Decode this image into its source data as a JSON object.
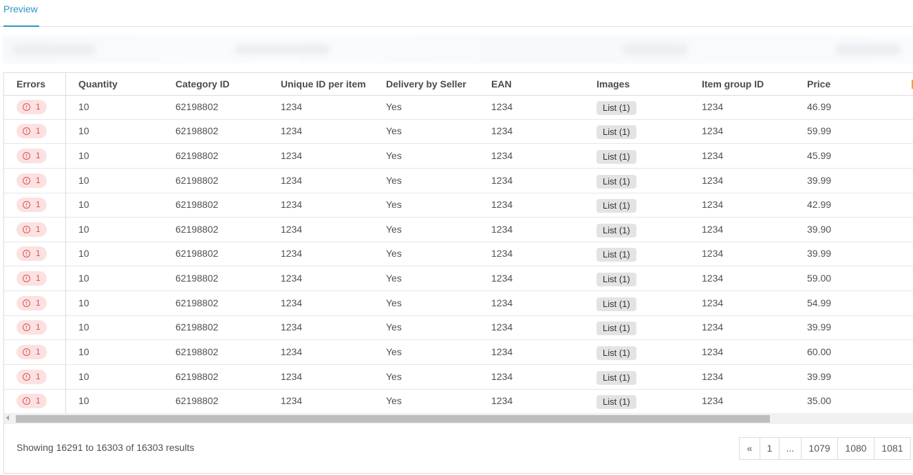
{
  "tabs": [
    {
      "label": "Preview"
    }
  ],
  "table": {
    "headers": [
      "Errors",
      "Quantity",
      "Category ID",
      "Unique ID per item",
      "Delivery by Seller",
      "EAN",
      "Images",
      "Item group ID",
      "Price"
    ],
    "rows": [
      {
        "errors": "1",
        "quantity": "10",
        "category_id": "62198802",
        "unique_id": "1234",
        "delivery": "Yes",
        "ean": "1234",
        "images": "List (1)",
        "item_group_id": "1234",
        "price": "46.99"
      },
      {
        "errors": "1",
        "quantity": "10",
        "category_id": "62198802",
        "unique_id": "1234",
        "delivery": "Yes",
        "ean": "1234",
        "images": "List (1)",
        "item_group_id": "1234",
        "price": "59.99"
      },
      {
        "errors": "1",
        "quantity": "10",
        "category_id": "62198802",
        "unique_id": "1234",
        "delivery": "Yes",
        "ean": "1234",
        "images": "List (1)",
        "item_group_id": "1234",
        "price": "45.99"
      },
      {
        "errors": "1",
        "quantity": "10",
        "category_id": "62198802",
        "unique_id": "1234",
        "delivery": "Yes",
        "ean": "1234",
        "images": "List (1)",
        "item_group_id": "1234",
        "price": "39.99"
      },
      {
        "errors": "1",
        "quantity": "10",
        "category_id": "62198802",
        "unique_id": "1234",
        "delivery": "Yes",
        "ean": "1234",
        "images": "List (1)",
        "item_group_id": "1234",
        "price": "42.99"
      },
      {
        "errors": "1",
        "quantity": "10",
        "category_id": "62198802",
        "unique_id": "1234",
        "delivery": "Yes",
        "ean": "1234",
        "images": "List (1)",
        "item_group_id": "1234",
        "price": "39.90"
      },
      {
        "errors": "1",
        "quantity": "10",
        "category_id": "62198802",
        "unique_id": "1234",
        "delivery": "Yes",
        "ean": "1234",
        "images": "List (1)",
        "item_group_id": "1234",
        "price": "39.99"
      },
      {
        "errors": "1",
        "quantity": "10",
        "category_id": "62198802",
        "unique_id": "1234",
        "delivery": "Yes",
        "ean": "1234",
        "images": "List (1)",
        "item_group_id": "1234",
        "price": "59.00"
      },
      {
        "errors": "1",
        "quantity": "10",
        "category_id": "62198802",
        "unique_id": "1234",
        "delivery": "Yes",
        "ean": "1234",
        "images": "List (1)",
        "item_group_id": "1234",
        "price": "54.99"
      },
      {
        "errors": "1",
        "quantity": "10",
        "category_id": "62198802",
        "unique_id": "1234",
        "delivery": "Yes",
        "ean": "1234",
        "images": "List (1)",
        "item_group_id": "1234",
        "price": "39.99"
      },
      {
        "errors": "1",
        "quantity": "10",
        "category_id": "62198802",
        "unique_id": "1234",
        "delivery": "Yes",
        "ean": "1234",
        "images": "List (1)",
        "item_group_id": "1234",
        "price": "60.00"
      },
      {
        "errors": "1",
        "quantity": "10",
        "category_id": "62198802",
        "unique_id": "1234",
        "delivery": "Yes",
        "ean": "1234",
        "images": "List (1)",
        "item_group_id": "1234",
        "price": "39.99"
      },
      {
        "errors": "1",
        "quantity": "10",
        "category_id": "62198802",
        "unique_id": "1234",
        "delivery": "Yes",
        "ean": "1234",
        "images": "List (1)",
        "item_group_id": "1234",
        "price": "35.00"
      }
    ]
  },
  "footer": {
    "results_text": "Showing 16291 to 16303 of 16303 results"
  },
  "pagination": {
    "items": [
      "«",
      "1",
      "...",
      "1079",
      "1080",
      "1081"
    ]
  },
  "colors": {
    "accent": "#2e96c8",
    "error_bg": "#fbe1e1",
    "error_text": "#d9534f",
    "list_btn_bg": "#e3e3e3"
  },
  "icons": {
    "error": "alert-circle-icon",
    "scroll_left": "chevron-left-icon"
  }
}
